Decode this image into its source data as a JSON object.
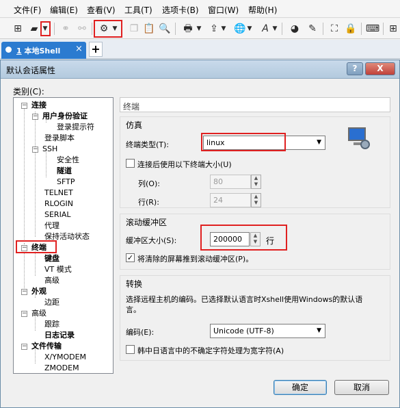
{
  "menu": [
    "文件(F)",
    "编辑(E)",
    "查看(V)",
    "工具(T)",
    "选项卡(B)",
    "窗口(W)",
    "帮助(H)"
  ],
  "tab": {
    "number": "1",
    "label": "本地Shell",
    "close": "×",
    "add": "+"
  },
  "dialog": {
    "title": "默认会话属性",
    "help_btn": "?",
    "close_btn": "X",
    "category_label": "类别(C):",
    "ok": "确定",
    "cancel": "取消"
  },
  "tree": {
    "connection": "连接",
    "auth": "用户身份验证",
    "login_prompt": "登录提示符",
    "login_script": "登录脚本",
    "ssh": "SSH",
    "security": "安全性",
    "tunnel": "隧道",
    "sftp": "SFTP",
    "telnet": "TELNET",
    "rlogin": "RLOGIN",
    "serial": "SERIAL",
    "proxy": "代理",
    "keepalive": "保持活动状态",
    "terminal": "终端",
    "keyboard": "键盘",
    "vt_mode": "VT 模式",
    "advanced": "高级",
    "appearance": "外观",
    "margin": "边距",
    "advanced2": "高级",
    "trace": "跟踪",
    "logging": "日志记录",
    "file_transfer": "文件传输",
    "xymodem": "X/YMODEM",
    "zmodem": "ZMODEM"
  },
  "panel": {
    "header": "终端",
    "emulation": {
      "title": "仿真",
      "term_type_label": "终端类型(T):",
      "term_type_value": "linux",
      "size_checkbox": "连接后使用以下终端大小(U)",
      "cols_label": "列(O):",
      "cols_value": "80",
      "rows_label": "行(R):",
      "rows_value": "24"
    },
    "scroll": {
      "title": "滚动缓冲区",
      "buffer_label": "缓冲区大小(S):",
      "buffer_value": "200000",
      "unit": "行",
      "push_checkbox": "将清除的屏幕推到滚动缓冲区(P)。"
    },
    "translation": {
      "title": "转换",
      "desc_line1": "选择远程主机的编码。已选择默认语言时Xshell使用Windows的默认语",
      "desc_line2": "言。",
      "encoding_label": "编码(E):",
      "encoding_value": "Unicode (UTF-8)",
      "cjk_checkbox": "韩中日语言中的不确定字符处理为宽字符(A)"
    }
  },
  "colors": {
    "highlight": "#e02020",
    "tab": "#2b7bd0"
  }
}
